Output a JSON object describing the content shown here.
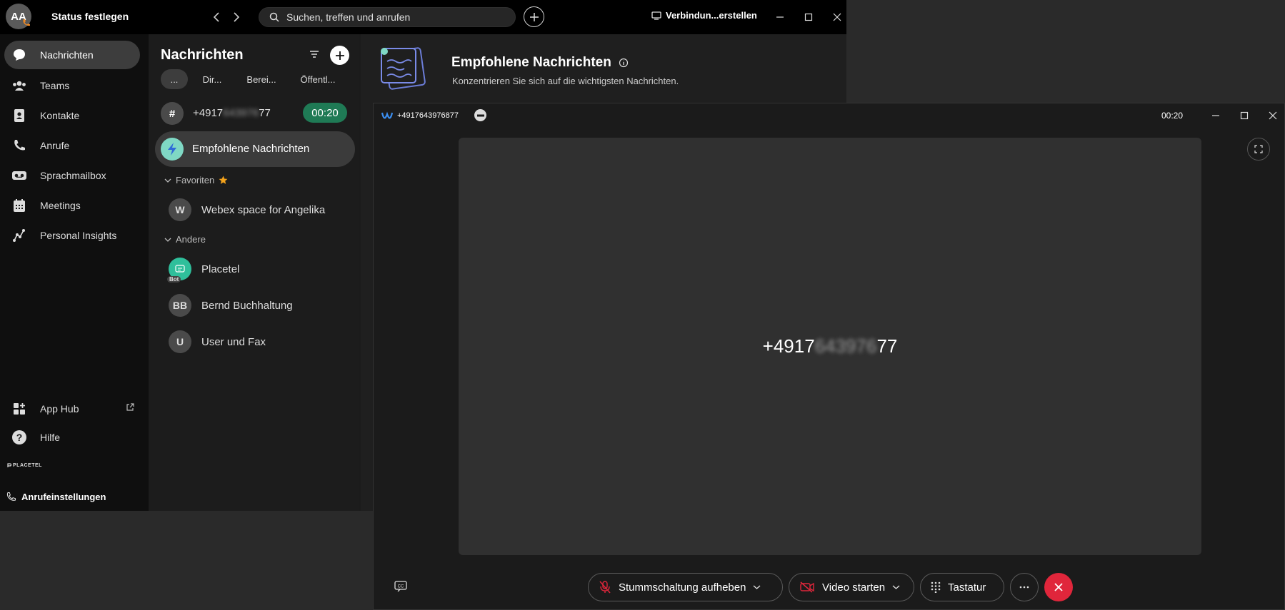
{
  "titlebar": {
    "avatar_initials": "AA",
    "status_label": "Status festlegen",
    "search_placeholder": "Suchen, treffen und anrufen",
    "connect_label": "Verbindun...erstellen"
  },
  "sidebar": {
    "items": [
      {
        "label": "Nachrichten",
        "icon": "chat-bubble-icon",
        "active": true
      },
      {
        "label": "Teams",
        "icon": "people-icon"
      },
      {
        "label": "Kontakte",
        "icon": "contacts-icon"
      },
      {
        "label": "Anrufe",
        "icon": "phone-icon"
      },
      {
        "label": "Sprachmailbox",
        "icon": "voicemail-icon"
      },
      {
        "label": "Meetings",
        "icon": "calendar-icon"
      },
      {
        "label": "Personal Insights",
        "icon": "insights-icon"
      }
    ],
    "app_hub": "App Hub",
    "help": "Hilfe",
    "brand": "PLACETEL",
    "call_settings": "Anrufeinstellungen"
  },
  "messages": {
    "title": "Nachrichten",
    "filters": [
      "...",
      "Dir...",
      "Berei...",
      "Öffentl..."
    ],
    "active_call": {
      "prefix": "+4917",
      "hidden": "643976",
      "suffix": "77",
      "timer": "00:20"
    },
    "recommended": "Empfohlene Nachrichten",
    "favorites_header": "Favoriten",
    "favorites": [
      {
        "initials": "W",
        "name": "Webex space for Angelika"
      }
    ],
    "others_header": "Andere",
    "others": [
      {
        "initials": "",
        "name": "Placetel",
        "bot_badge": "Bot"
      },
      {
        "initials": "BB",
        "name": "Bernd Buchhaltung"
      },
      {
        "initials": "U",
        "name": "User und Fax"
      }
    ]
  },
  "content": {
    "title": "Empfohlene Nachrichten",
    "subtitle": "Konzentrieren Sie sich auf die wichtigsten Nachrichten."
  },
  "call": {
    "window_title": "+4917643976877",
    "timer": "00:20",
    "caller_prefix": "+4917",
    "caller_hidden": "643976",
    "caller_suffix": "77",
    "mute_label": "Stummschaltung aufheben",
    "video_label": "Video starten",
    "keypad_label": "Tastatur"
  },
  "colors": {
    "accent_green": "#1f7a55",
    "hangup_red": "#e0263b",
    "bolt_bg": "#7fd8c4",
    "placetel_bot": "#2fbf9b"
  }
}
